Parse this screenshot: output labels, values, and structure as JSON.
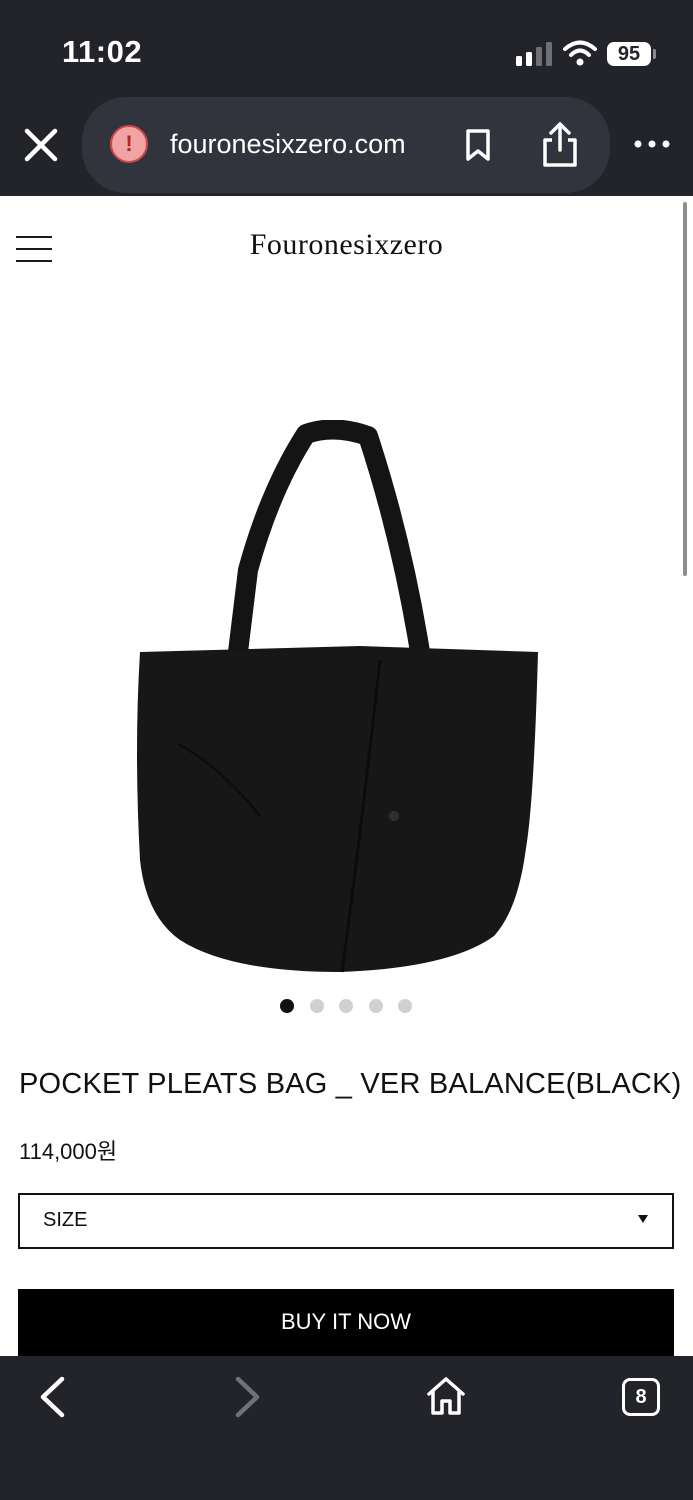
{
  "status_bar": {
    "time": "11:02",
    "battery": "95"
  },
  "browser": {
    "url": "fouronesixzero.com",
    "tab_count": "8"
  },
  "site": {
    "logo": "Fouronesixzero"
  },
  "product": {
    "title": "POCKET PLEATS BAG _ VER BALANCE(BLACK)",
    "price": "114,000원",
    "size_select_label": "SIZE",
    "buy_label": "BUY IT NOW",
    "image_count": 5,
    "active_image_index": 0
  },
  "colors": {
    "chrome_bg": "#22242a",
    "url_pill_bg": "#31343c",
    "warning": "#f2a3a3",
    "button_bg": "#000000"
  },
  "icons": [
    "close-icon",
    "warning-icon",
    "bookmark-icon",
    "share-icon",
    "more-icon",
    "hamburger-menu-icon",
    "back-icon",
    "forward-icon",
    "home-icon",
    "tabs-icon"
  ]
}
